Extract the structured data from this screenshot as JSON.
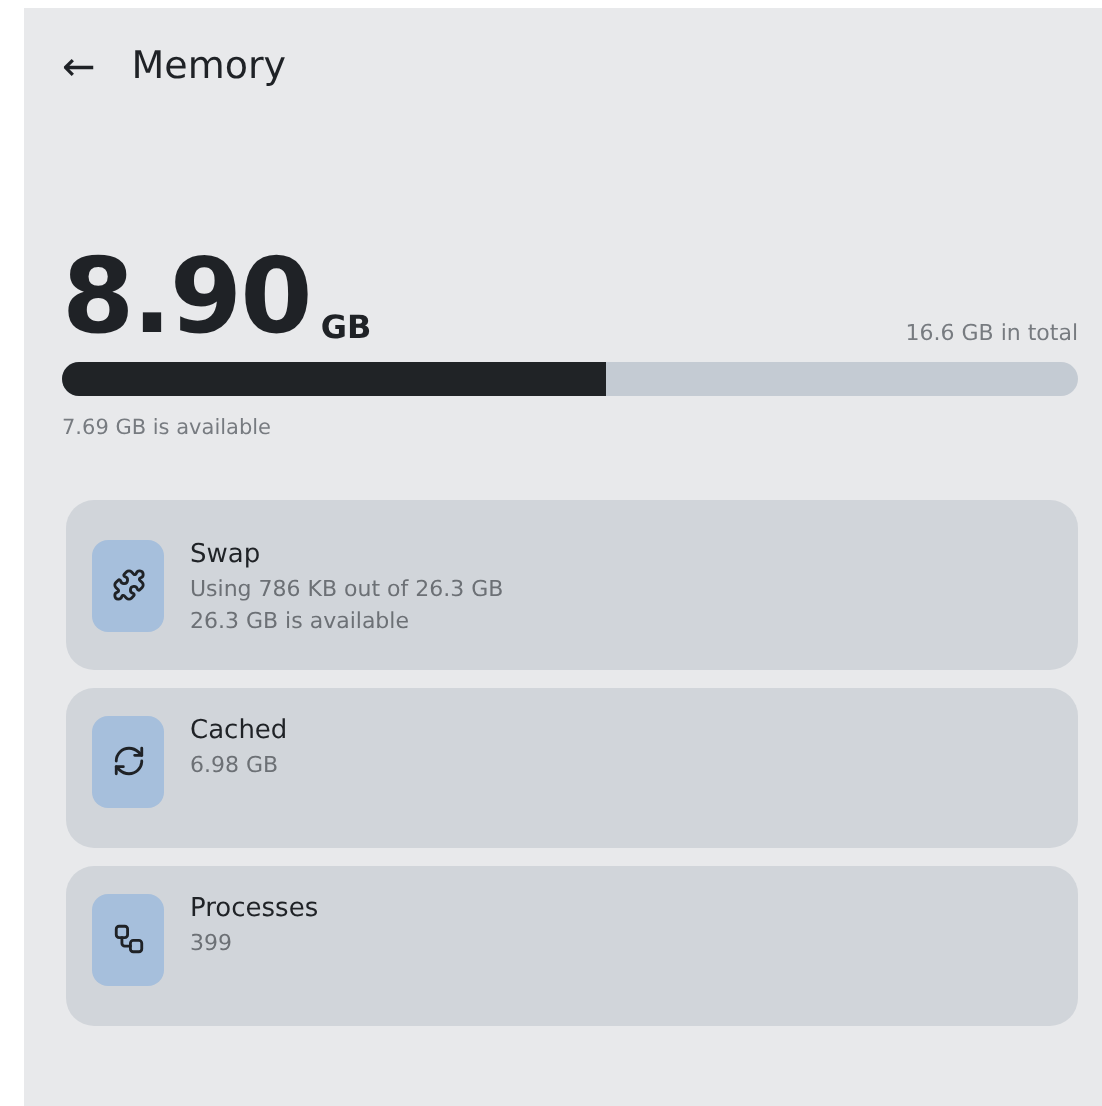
{
  "header": {
    "back": "←",
    "title": "Memory"
  },
  "usage": {
    "value": "8.90",
    "unit": "GB",
    "total": "16.6 GB in total",
    "level": 0.536,
    "available": "7.69 GB is available"
  },
  "cards": [
    {
      "kind": "puzzle",
      "title": "Swap",
      "lines": [
        "Using 786 KB out of 26.3 GB",
        "26.3 GB is available"
      ]
    },
    {
      "kind": "refresh",
      "title": "Cached",
      "lines": [
        "6.98 GB"
      ]
    },
    {
      "kind": "tree",
      "title": "Processes",
      "lines": [
        "399"
      ]
    }
  ]
}
